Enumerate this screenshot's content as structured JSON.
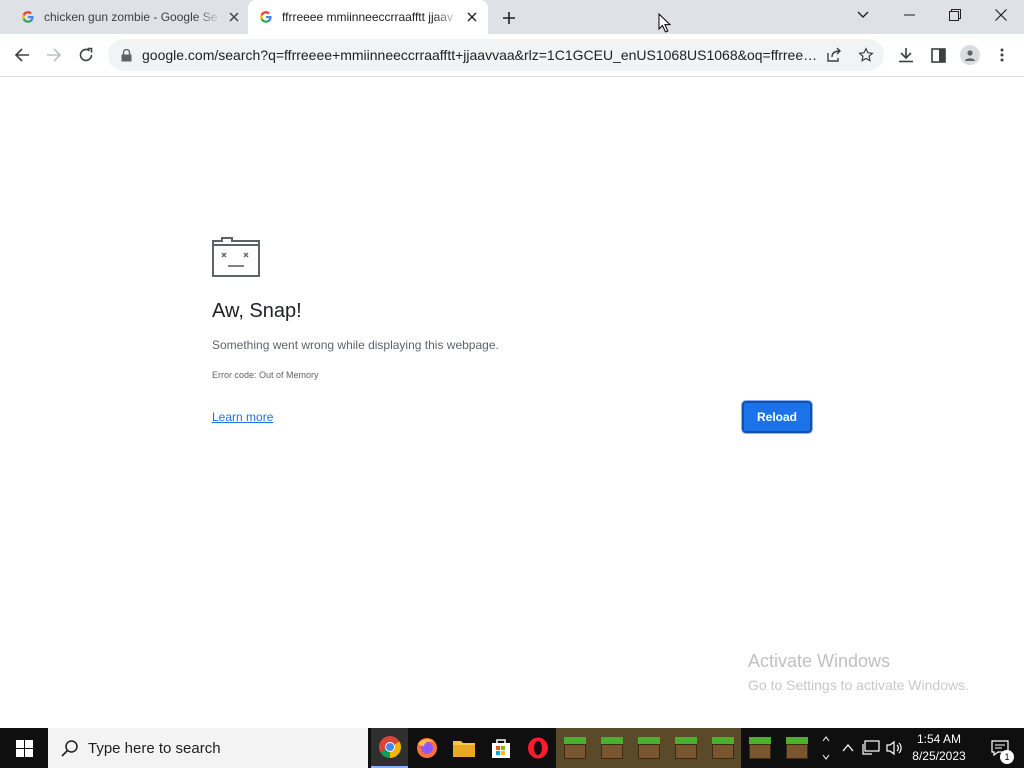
{
  "browser": {
    "tabs": [
      {
        "title": "chicken gun zombie - Google Se",
        "active": false
      },
      {
        "title": "ffrreeee mmiinneeccrraafftt jjaav",
        "active": true
      }
    ],
    "url": "google.com/search?q=ffrreeee+mmiinneeccrraafftt+jjaavvaa&rlz=1C1GCEU_enUS1068US1068&oq=ffrreee...",
    "icons": {
      "back": "arrow-left-icon",
      "forward": "arrow-right-icon",
      "reload": "refresh-icon",
      "lock": "lock-icon",
      "share": "share-icon",
      "bookmark": "star-icon",
      "download": "download-icon",
      "side_panel": "side-panel-icon",
      "profile": "profile-icon",
      "menu": "kebab-menu-icon"
    }
  },
  "error_page": {
    "title": "Aw, Snap!",
    "description": "Something went wrong while displaying this webpage.",
    "error_code": "Error code: Out of Memory",
    "learn_more": "Learn more",
    "reload": "Reload"
  },
  "watermark": {
    "title": "Activate Windows",
    "subtitle": "Go to Settings to activate Windows."
  },
  "taskbar": {
    "search_placeholder": "Type here to search",
    "apps": [
      "chrome-icon",
      "firefox-icon",
      "file-explorer-icon",
      "microsoft-store-icon",
      "opera-icon",
      "minecraft-icon",
      "minecraft-icon",
      "minecraft-icon",
      "minecraft-icon",
      "minecraft-icon",
      "minecraft-icon",
      "minecraft-icon"
    ],
    "time": "1:54 AM",
    "date": "8/25/2023",
    "notification_count": "1"
  },
  "colors": {
    "accent": "#1a73e8",
    "tabstrip": "#dee1e6",
    "taskbar": "#0f0f0f"
  }
}
